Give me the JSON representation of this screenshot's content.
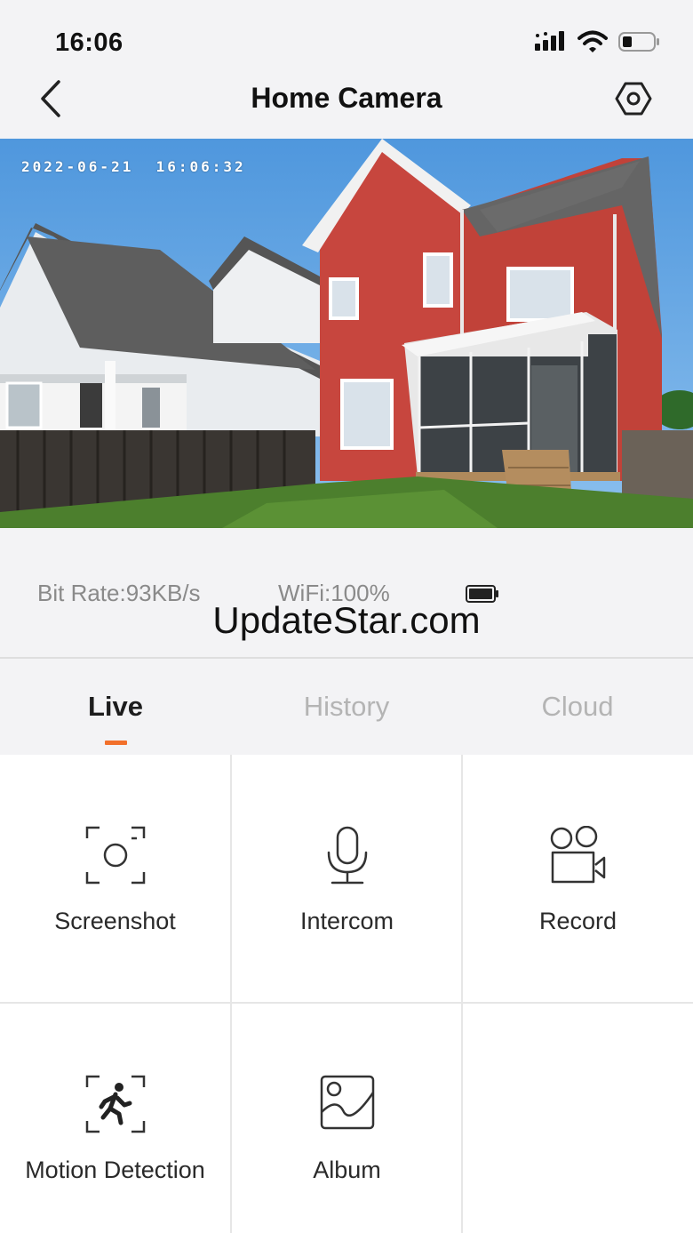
{
  "status_bar": {
    "time": "16:06",
    "icons": [
      "signal-icon",
      "wifi-icon",
      "battery-icon"
    ]
  },
  "nav": {
    "title": "Home Camera",
    "back_icon": "chevron-left-icon",
    "settings_icon": "hexagon-settings-icon"
  },
  "video": {
    "timestamp": "2022-06-21  16:06:32"
  },
  "stats": {
    "bitrate": "Bit Rate:93KB/s",
    "wifi": "WiFi:100%",
    "battery_icon": "battery-icon"
  },
  "watermark": "UpdateStar.com",
  "tabs": [
    {
      "label": "Live",
      "active": true
    },
    {
      "label": "History",
      "active": false
    },
    {
      "label": "Cloud",
      "active": false
    }
  ],
  "accent_color": "#f2702b",
  "actions": [
    {
      "label": "Screenshot",
      "icon": "screenshot-icon"
    },
    {
      "label": "Intercom",
      "icon": "microphone-icon"
    },
    {
      "label": "Record",
      "icon": "video-camera-icon"
    },
    {
      "label": "Motion Detection",
      "icon": "motion-detection-icon"
    },
    {
      "label": "Album",
      "icon": "album-icon"
    }
  ]
}
